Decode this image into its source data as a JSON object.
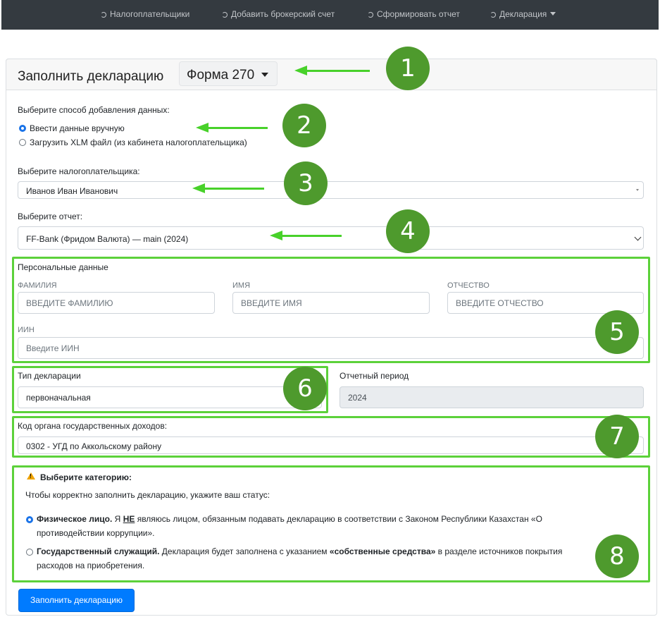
{
  "nav": {
    "items": [
      {
        "label": "Налогоплательщики"
      },
      {
        "label": "Добавить брокерский счет"
      },
      {
        "label": "Сформировать отчет"
      },
      {
        "label": "Декларация"
      }
    ]
  },
  "header": {
    "title": "Заполнить декларацию",
    "form_select": "Форма 270"
  },
  "add_method": {
    "label": "Выберите способ добавления данных:",
    "options": [
      {
        "label": "Ввести данные вручную",
        "selected": true
      },
      {
        "label": "Загрузить XLM файл (из кабинета налогоплательщика)",
        "selected": false
      }
    ]
  },
  "taxpayer": {
    "label": "Выберите налогоплательщика:",
    "value": "Иванов Иван Иванович"
  },
  "report": {
    "label": "Выберите отчет:",
    "value": "FF-Bank (Фридом Валюта) — main (2024)"
  },
  "personal": {
    "title": "Персональные данные",
    "surname": {
      "label": "Фамилия",
      "placeholder": "ВВЕДИТЕ ФАМИЛИЮ"
    },
    "name": {
      "label": "Имя",
      "placeholder": "ВВЕДИТЕ ИМЯ"
    },
    "patronymic": {
      "label": "Отчество",
      "placeholder": "ВВЕДИТЕ ОТЧЕСТВО"
    },
    "iin": {
      "label": "ИИН",
      "placeholder": "Введите ИИН"
    }
  },
  "declaration_type": {
    "label": "Тип декларации",
    "value": "первоначальная"
  },
  "period": {
    "label": "Отчетный период",
    "value": "2024"
  },
  "revenue_body": {
    "label": "Код органа государственных доходов:",
    "value": "0302 - УГД по Аккольскому району"
  },
  "category": {
    "title": "Выберите категорию:",
    "subtitle": "Чтобы корректно заполнить декларацию, укажите ваш статус:",
    "opt1_bold": "Физическое лицо.",
    "opt1_a": " Я ",
    "opt1_u": "НЕ",
    "opt1_b": " являюсь лицом, обязанным подавать декларацию в соответствии с Законом Республики Казахстан «О противодействии коррупции».",
    "opt2_bold": "Государственный служащий.",
    "opt2_a": " Декларация будет заполнена с указанием ",
    "opt2_bold2": "«собственные средства»",
    "opt2_b": " в разделе источников покрытия расходов на приобретения."
  },
  "submit_label": "Заполнить декларацию",
  "markers": [
    "1",
    "2",
    "3",
    "4",
    "5",
    "6",
    "7",
    "8"
  ],
  "colors": {
    "navbar": "#343a40",
    "primary": "#007bff",
    "annotation_green": "#5cd13a",
    "marker_green": "#4e9a2d"
  }
}
